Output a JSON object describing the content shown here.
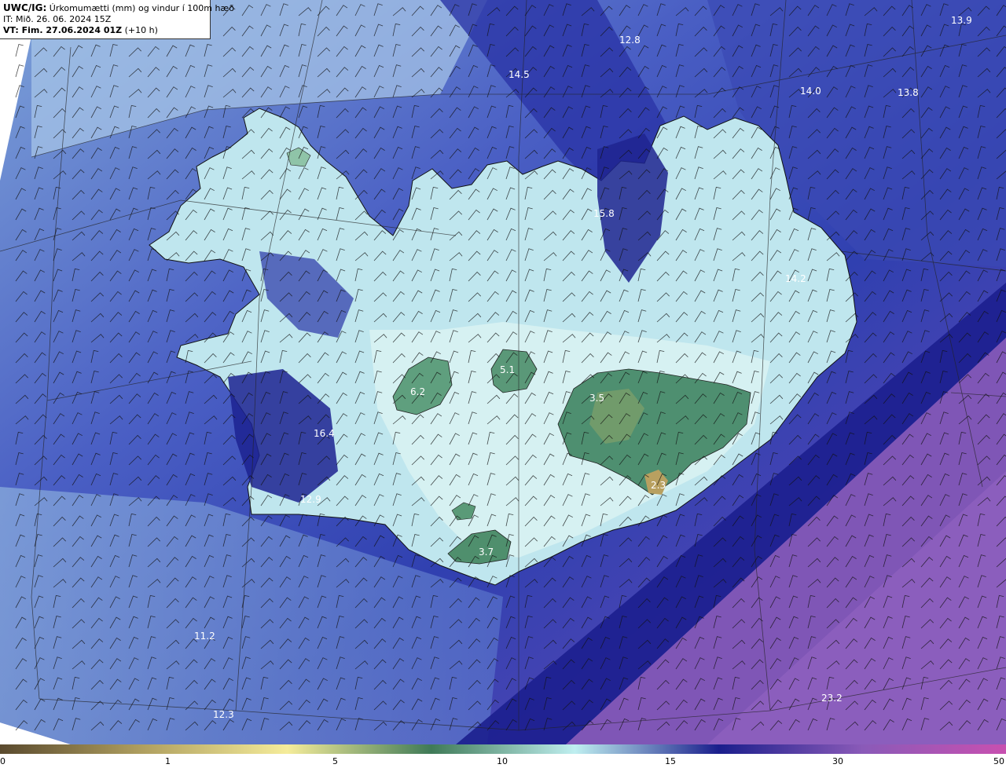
{
  "info": {
    "title_prefix": "UWC/IG:",
    "title_rest": " Úrkomumætti (mm) og vindur í 100m hæð",
    "it": "IT: Mið. 26. 06. 2024 15Z",
    "vt_prefix": "VT: Fim. 27.06.2024 01Z",
    "vt_rest": " (+10 h)"
  },
  "map_values": [
    {
      "id": "v1",
      "text": "13.9"
    },
    {
      "id": "v2",
      "text": "12.8"
    },
    {
      "id": "v3",
      "text": "14.5"
    },
    {
      "id": "v4",
      "text": "14.0"
    },
    {
      "id": "v5",
      "text": "13.8"
    },
    {
      "id": "v6",
      "text": "15.8"
    },
    {
      "id": "v7",
      "text": "14.2"
    },
    {
      "id": "v8",
      "text": "5.1"
    },
    {
      "id": "v9",
      "text": "6.2"
    },
    {
      "id": "v10",
      "text": "3.5"
    },
    {
      "id": "v11",
      "text": "16.4"
    },
    {
      "id": "v12",
      "text": "12.9"
    },
    {
      "id": "v13",
      "text": "2.3"
    },
    {
      "id": "v14",
      "text": "3.7"
    },
    {
      "id": "v15",
      "text": "11.2"
    },
    {
      "id": "v16",
      "text": "12.3"
    },
    {
      "id": "v17",
      "text": "23.2"
    }
  ],
  "colorbar": {
    "ticks": [
      "0",
      "1",
      "5",
      "10",
      "15",
      "30",
      "50"
    ],
    "colors": [
      "#5a4a2e",
      "#b0a060",
      "#f5ec9a",
      "#3f7a57",
      "#bfeff0",
      "#1a1e8c",
      "#8a5ab8",
      "#c850b0"
    ]
  },
  "palette": {
    "deep_navy": "#1a1e8c",
    "blue": "#3a44b0",
    "light_blue": "#8fb0dd",
    "ice": "#d8f0f2",
    "green": "#5c9a7a",
    "purple": "#7d58b8"
  }
}
